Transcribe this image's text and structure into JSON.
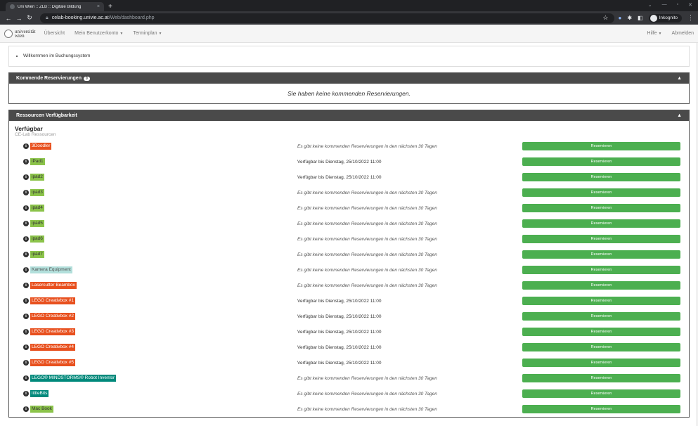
{
  "browser": {
    "tab_title": "Uni Wien :: ZLB :: Digitale Bildung",
    "tab_close": "×",
    "new_tab": "+",
    "url_host": "celab-booking.univie.ac.at",
    "url_path": "/Web/dashboard.php",
    "profile_label": "Inkognito"
  },
  "nav": {
    "logo_line1": "universität",
    "logo_line2": "wien",
    "items": [
      {
        "label": "Übersicht"
      },
      {
        "label": "Mein Benutzerkonto",
        "dropdown": true
      },
      {
        "label": "Terminplan",
        "dropdown": true
      }
    ],
    "help": "Hilfe",
    "logout": "Abmelden"
  },
  "welcome": {
    "message": "Willkommen im Buchungssystem"
  },
  "upcoming": {
    "title": "Kommende Reservierungen",
    "count": "0",
    "empty_text": "Sie haben keine kommenden Reservierungen."
  },
  "availability": {
    "title": "Ressourcen Verfügbarkeit",
    "section": "Verfügbar",
    "group": "CE-Lab Ressourcen",
    "button_label": "Reservieren",
    "rows": [
      {
        "name": "3Doodler",
        "color": "#e8501e",
        "text_color": "#ffffff",
        "status": "Es gibt keine kommenden Reservierungen in den nächsten 30 Tagen",
        "italic": true
      },
      {
        "name": "iPad1",
        "color": "#8bc34a",
        "text_color": "#333333",
        "status": "Verfügbar bis Dienstag, 25/10/2022 11:00",
        "italic": false
      },
      {
        "name": "ipad2",
        "color": "#8bc34a",
        "text_color": "#333333",
        "status": "Verfügbar bis Dienstag, 25/10/2022 11:00",
        "italic": false
      },
      {
        "name": "ipad3",
        "color": "#8bc34a",
        "text_color": "#333333",
        "status": "Es gibt keine kommenden Reservierungen in den nächsten 30 Tagen",
        "italic": true
      },
      {
        "name": "ipad4",
        "color": "#8bc34a",
        "text_color": "#333333",
        "status": "Es gibt keine kommenden Reservierungen in den nächsten 30 Tagen",
        "italic": true
      },
      {
        "name": "ipad5",
        "color": "#8bc34a",
        "text_color": "#333333",
        "status": "Es gibt keine kommenden Reservierungen in den nächsten 30 Tagen",
        "italic": true
      },
      {
        "name": "ipad6",
        "color": "#8bc34a",
        "text_color": "#333333",
        "status": "Es gibt keine kommenden Reservierungen in den nächsten 30 Tagen",
        "italic": true
      },
      {
        "name": "ipad7",
        "color": "#8bc34a",
        "text_color": "#333333",
        "status": "Es gibt keine kommenden Reservierungen in den nächsten 30 Tagen",
        "italic": true
      },
      {
        "name": "Kamera Equipment",
        "color": "#b2dfdb",
        "text_color": "#555555",
        "status": "Es gibt keine kommenden Reservierungen in den nächsten 30 Tagen",
        "italic": true
      },
      {
        "name": "Lasercutter Beambox",
        "color": "#e8501e",
        "text_color": "#ffffff",
        "status": "Es gibt keine kommenden Reservierungen in den nächsten 30 Tagen",
        "italic": true
      },
      {
        "name": "LEGO Creativbox #1",
        "color": "#e8501e",
        "text_color": "#ffffff",
        "status": "Verfügbar bis Dienstag, 25/10/2022 11:00",
        "italic": false
      },
      {
        "name": "LEGO Creativbox #2",
        "color": "#e8501e",
        "text_color": "#ffffff",
        "status": "Verfügbar bis Dienstag, 25/10/2022 11:00",
        "italic": false
      },
      {
        "name": "LEGO Creativbox #3",
        "color": "#e8501e",
        "text_color": "#ffffff",
        "status": "Verfügbar bis Dienstag, 25/10/2022 11:00",
        "italic": false
      },
      {
        "name": "LEGO Creativbox #4",
        "color": "#e8501e",
        "text_color": "#ffffff",
        "status": "Verfügbar bis Dienstag, 25/10/2022 11:00",
        "italic": false
      },
      {
        "name": "LEGO Creativbox #5",
        "color": "#e8501e",
        "text_color": "#ffffff",
        "status": "Verfügbar bis Dienstag, 25/10/2022 11:00",
        "italic": false
      },
      {
        "name": "LEGO® MINDSTORMS® Robot Inventor",
        "color": "#00897b",
        "text_color": "#ffffff",
        "status": "Es gibt keine kommenden Reservierungen in den nächsten 30 Tagen",
        "italic": true
      },
      {
        "name": "littleBits",
        "color": "#00897b",
        "text_color": "#ffffff",
        "status": "Es gibt keine kommenden Reservierungen in den nächsten 30 Tagen",
        "italic": true
      },
      {
        "name": "Mac Book",
        "color": "#8bc34a",
        "text_color": "#333333",
        "status": "Es gibt keine kommenden Reservierungen in den nächsten 30 Tagen",
        "italic": true
      }
    ]
  }
}
